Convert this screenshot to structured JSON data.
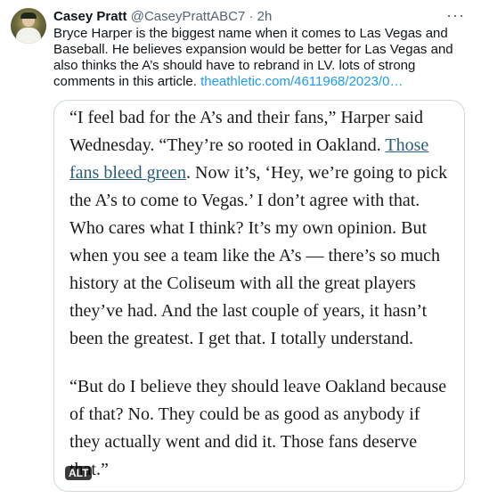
{
  "tweet": {
    "author_name": "Casey Pratt",
    "handle": "@CaseyPrattABC7",
    "separator": "·",
    "time": "2h",
    "more_icon": "ellipsis-icon",
    "text": "Bryce Harper is the biggest name when it comes to Las Vegas and Baseball. He believes expansion would be better for Las Vegas and also thinks the A’s should have to rebrand in LV. lots of strong comments in this article.",
    "link_text": "theathletic.com/4611968/2023/0…",
    "accent_color": "#1d9bf0"
  },
  "image": {
    "alt_badge": "ALT",
    "para1_before": "“I feel bad for the A’s and their fans,” Harper said Wednesday. “They’re so rooted in Oakland.",
    "para1_link": "Those fans bleed green",
    "para1_after": ". Now it’s, ‘Hey, we’re going to pick the A’s to come to Vegas.’ I don’t agree with that. Who cares what I think? It’s my own opinion. But when you see a team like the A’s — there’s so much history at the Coliseum with all the great players they’ve had. And the last couple of years, it hasn’t been the greatest. I get that. I totally understand.",
    "para2": "“But do I believe they should leave Oakland because of that? No. They could be as good as anybody if they actually went and did it. Those fans deserve that.”"
  }
}
